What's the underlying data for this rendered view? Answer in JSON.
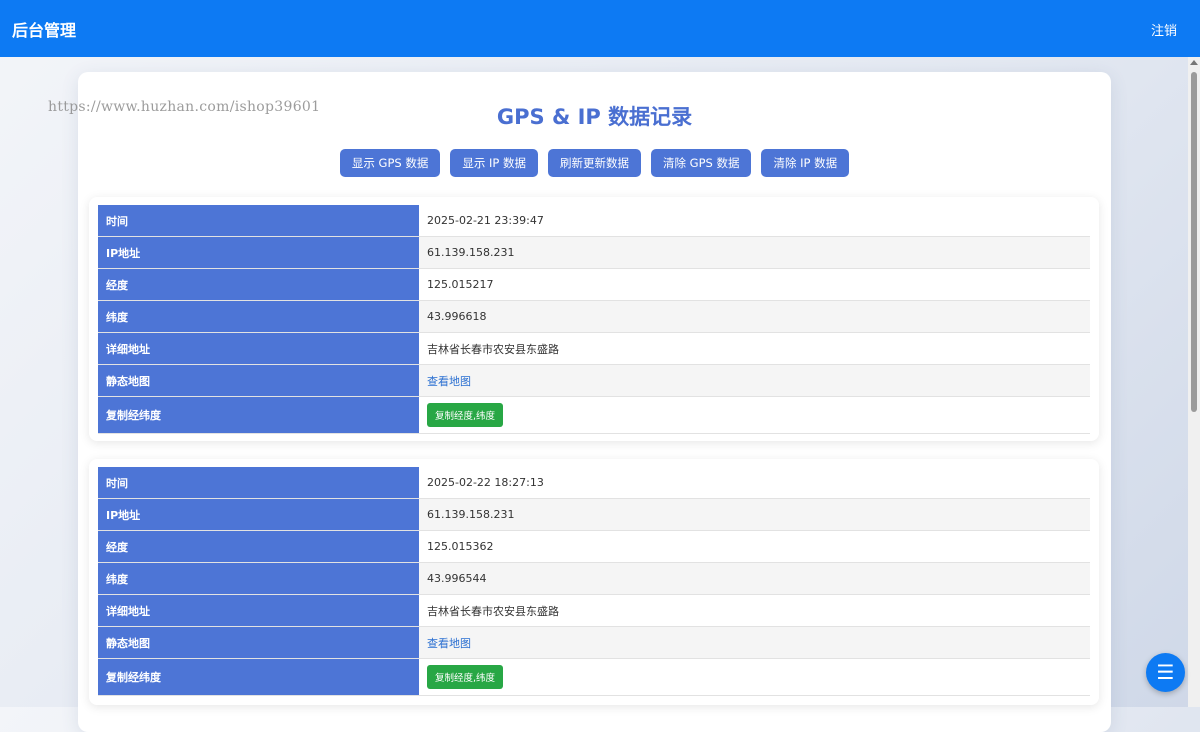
{
  "header": {
    "title": "后台管理",
    "logout_label": "注销"
  },
  "watermark": "https://www.huzhan.com/ishop39601",
  "page_title": "GPS & IP 数据记录",
  "toolbar": [
    "显示 GPS 数据",
    "显示 IP 数据",
    "刷新更新数据",
    "清除 GPS 数据",
    "清除 IP 数据"
  ],
  "labels": {
    "time": "时间",
    "ip": "IP地址",
    "lng": "经度",
    "lat": "纬度",
    "address": "详细地址",
    "map": "静态地图",
    "copy": "复制经纬度"
  },
  "records": [
    {
      "time": "2025-02-21 23:39:47",
      "ip": "61.139.158.231",
      "lng": "125.015217",
      "lat": "43.996618",
      "address": "吉林省长春市农安县东盛路",
      "map_link": "查看地图",
      "copy_button": "复制经度,纬度"
    },
    {
      "time": "2025-02-22 18:27:13",
      "ip": "61.139.158.231",
      "lng": "125.015362",
      "lat": "43.996544",
      "address": "吉林省长春市农安县东盛路",
      "map_link": "查看地图",
      "copy_button": "复制经度,纬度"
    }
  ],
  "fab_icon": "menu-icon",
  "colors": {
    "primary": "#0d7af3",
    "header_cell": "#4d75d6",
    "title": "#4a6fd1",
    "copy_button": "#28a745"
  }
}
